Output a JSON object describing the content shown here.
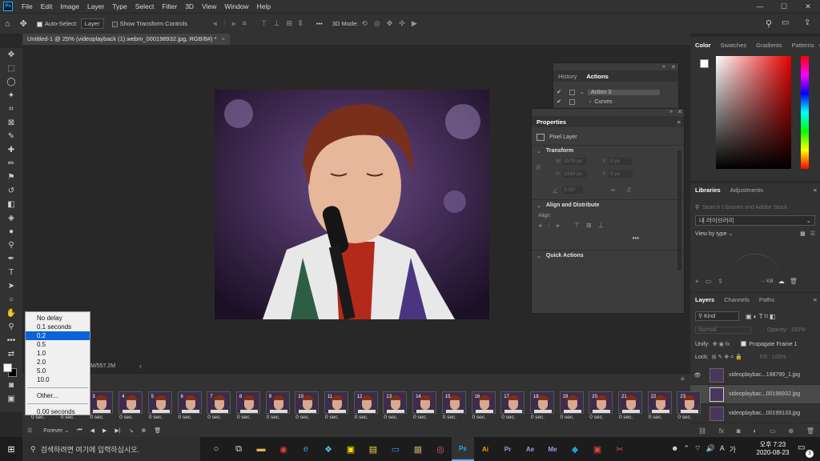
{
  "app": {
    "logo": "Ps"
  },
  "menu": [
    "File",
    "Edit",
    "Image",
    "Layer",
    "Type",
    "Select",
    "Filter",
    "3D",
    "View",
    "Window",
    "Help"
  ],
  "window_controls": {
    "minimize": "—",
    "maximize": "☐",
    "close": "✕"
  },
  "options_bar": {
    "auto_select_label": "Auto-Select:",
    "auto_select_target": "Layer",
    "show_transform_label": "Show Transform Controls",
    "more": "•••",
    "mode_3d_label": "3D Mode:"
  },
  "document_tab": {
    "title": "Untitled-1 @ 25% (videoplayback (1).webm_000198932.jpg, RGB/8#) *",
    "close": "×"
  },
  "status_bar": {
    "doc_size": "M/557.2M",
    "arrow": "›"
  },
  "history_panel": {
    "tabs": [
      "History",
      "Actions"
    ],
    "rows": [
      {
        "label": "Action 3"
      },
      {
        "label": "Curves"
      }
    ]
  },
  "properties_panel": {
    "title": "Properties",
    "layer_kind": "Pixel Layer",
    "transform": {
      "title": "Transform",
      "w_label": "W",
      "w_value": "2570 px",
      "x_label": "X",
      "x_value": "0 px",
      "h_label": "H",
      "h_value": "2160 px",
      "y_label": "Y",
      "y_value": "0 px",
      "angle_value": "0.00°"
    },
    "align": {
      "title": "Align and Distribute",
      "label": "Align:",
      "more": "•••"
    },
    "quick_actions": {
      "title": "Quick Actions"
    }
  },
  "color_panel": {
    "tabs": [
      "Color",
      "Swatches",
      "Gradients",
      "Patterns"
    ],
    "accent": "#e60000"
  },
  "libraries_panel": {
    "tabs": [
      "Libraries",
      "Adjustments"
    ],
    "search_placeholder": "Search Libraries and Adobe Stock",
    "library_select": "내 라이브러리",
    "view_by": "View by type",
    "size_label": "-- KB"
  },
  "layers_panel": {
    "tabs": [
      "Layers",
      "Channels",
      "Paths"
    ],
    "kind": "Kind",
    "blend_mode": "Normal",
    "opacity_label": "Opacity:",
    "opacity_value": "100%",
    "unify_label": "Unify:",
    "propagate_label": "Propagate Frame 1",
    "lock_label": "Lock:",
    "fill_label": "Fill:",
    "fill_value": "100%",
    "layers": [
      {
        "name": "videoplaybac...198799_1.jpg",
        "visible": true
      },
      {
        "name": "videoplaybac...00198932.jpg",
        "visible": false,
        "selected": true
      },
      {
        "name": "videoplaybac...00199133.jpg",
        "visible": false
      }
    ]
  },
  "timeline": {
    "frames": [
      {
        "num": "",
        "delay": "0 sec."
      },
      {
        "num": "",
        "delay": "0 sec."
      },
      {
        "num": "3",
        "delay": "0 sec."
      },
      {
        "num": "4",
        "delay": "0 sec."
      },
      {
        "num": "5",
        "delay": "0 sec."
      },
      {
        "num": "6",
        "delay": "0 sec."
      },
      {
        "num": "7",
        "delay": "0 sec."
      },
      {
        "num": "8",
        "delay": "0 sec."
      },
      {
        "num": "9",
        "delay": "0 sec."
      },
      {
        "num": "10",
        "delay": "0 sec."
      },
      {
        "num": "11",
        "delay": "0 sec."
      },
      {
        "num": "12",
        "delay": "0 sec."
      },
      {
        "num": "13",
        "delay": "0 sec."
      },
      {
        "num": "14",
        "delay": "0 sec."
      },
      {
        "num": "15",
        "delay": "0 sec."
      },
      {
        "num": "16",
        "delay": "0 sec."
      },
      {
        "num": "17",
        "delay": "0 sec."
      },
      {
        "num": "18",
        "delay": "0 sec."
      },
      {
        "num": "19",
        "delay": "0 sec."
      },
      {
        "num": "20",
        "delay": "0 sec."
      },
      {
        "num": "21",
        "delay": "0 sec."
      },
      {
        "num": "22",
        "delay": "0 sec."
      },
      {
        "num": "23",
        "delay": "0 sec."
      }
    ],
    "loop": "Forever"
  },
  "delay_menu": {
    "options": [
      "No delay",
      "0.1 seconds",
      "0.2",
      "0.5",
      "1.0",
      "2.0",
      "5.0",
      "10.0"
    ],
    "selected_index": 2,
    "other": "Other...",
    "current": "0.00 seconds"
  },
  "taskbar": {
    "search_placeholder": "검색하려면 여기에 입력하십시오.",
    "apps": [
      "Ps",
      "Ai",
      "Pr",
      "Ae",
      "Me"
    ],
    "ime": "A",
    "lang": "가",
    "time": "오후 7:23",
    "date": "2020-08-23",
    "notif_count": "3"
  }
}
